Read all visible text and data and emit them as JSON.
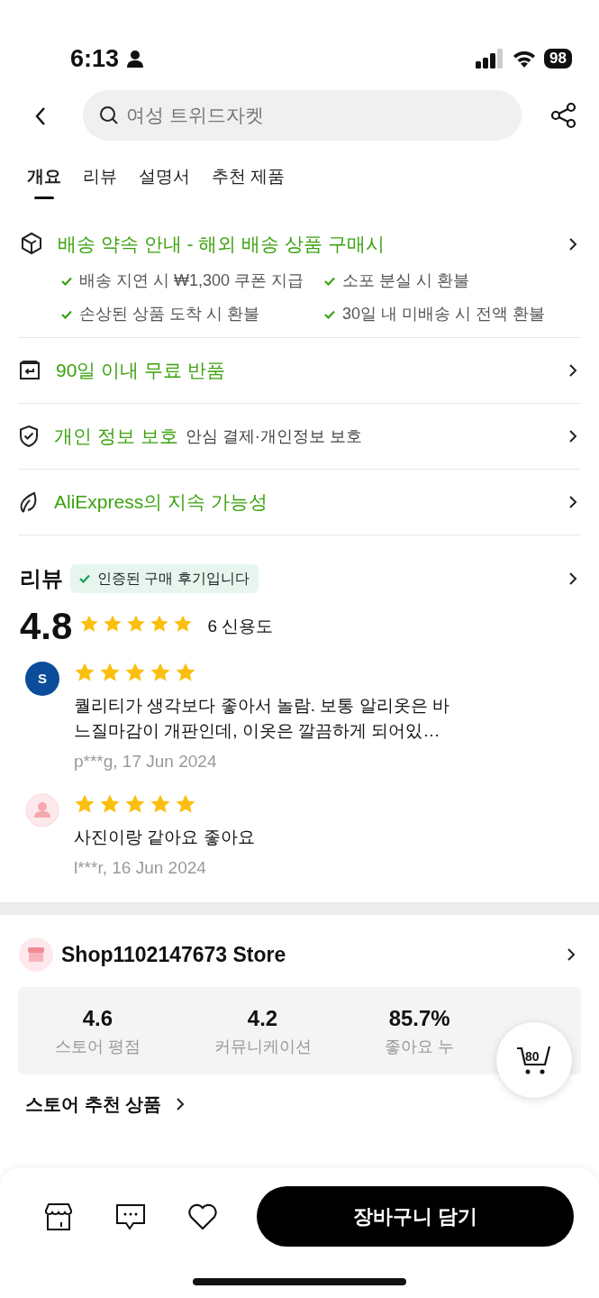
{
  "status_bar": {
    "time": "6:13",
    "battery": "98"
  },
  "search": {
    "placeholder": "여성 트위드자켓"
  },
  "tabs": [
    {
      "label": "개요",
      "selected": true
    },
    {
      "label": "리뷰",
      "selected": false
    },
    {
      "label": "설명서",
      "selected": false
    },
    {
      "label": "추천 제품",
      "selected": false
    }
  ],
  "delivery": {
    "title": "배송 약속 안내 - 해외 배송 상품 구매시",
    "guarantees": [
      "배송 지연 시 ₩1,300 쿠폰 지급",
      "소포 분실 시 환불",
      "손상된 상품 도착 시 환불",
      "30일 내 미배송 시 전액 환불"
    ]
  },
  "services": [
    {
      "title": "90일 이내 무료 반품"
    },
    {
      "title": "개인 정보 보호",
      "subtitle": "안심 결제·개인정보 보호"
    },
    {
      "title": "AliExpress의 지속 가능성"
    }
  ],
  "reviews": {
    "heading": "리뷰",
    "badge": "인증된 구매 후기입니다",
    "rating": "4.8",
    "stars": 5,
    "count": "6 신용도",
    "items": [
      {
        "kind": "initial",
        "avatar": "S",
        "stars": 5,
        "text": "퀄리티가 생각보다 좋아서 놀람. 보통 알리옷은 바느질마감이 개판인데, 이옷은 깔끔하게 되어있…",
        "meta": "p***g, 17 Jun 2024"
      },
      {
        "kind": "default",
        "stars": 5,
        "text": "사진이랑 같아요 좋아요",
        "meta": "l***r, 16 Jun 2024"
      }
    ]
  },
  "store": {
    "name": "Shop1102147673 Store",
    "stats": [
      {
        "value": "4.6",
        "label": "스토어 평점"
      },
      {
        "value": "4.2",
        "label": "커뮤니케이션"
      },
      {
        "value": "85.7%",
        "label": "좋아요 누"
      }
    ]
  },
  "cart": {
    "count": "80"
  },
  "recommended": {
    "title": "스토어 추천 상품"
  },
  "bottom_bar": {
    "cta": "장바구니 담기"
  }
}
